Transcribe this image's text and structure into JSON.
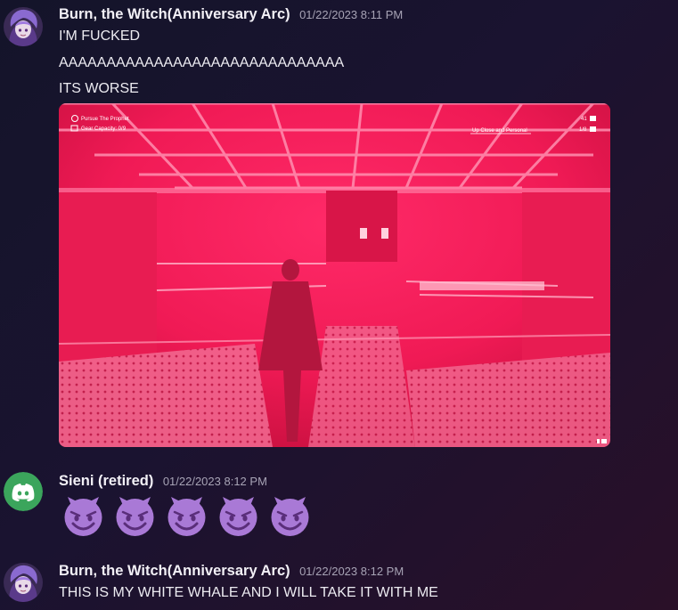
{
  "messages": [
    {
      "author": "Burn, the Witch(Anniversary Arc)",
      "timestamp": "01/22/2023 8:11 PM",
      "lines": [
        "I'M FUCKED",
        "AAAAAAAAAAAAAAAAAAAAAAAAAAAAAA",
        "ITS WORSE"
      ],
      "attachment": {
        "hud_objective": "Pursue The Prophet",
        "hud_gear": "Gear Capacity: 0/9",
        "hud_challenge": "Up Close and Personal",
        "hud_count": "41",
        "hud_progress": "1/8"
      }
    },
    {
      "author": "Sieni (retired)",
      "timestamp": "01/22/2023 8:12 PM",
      "emojis": [
        "smiling-imp",
        "smiling-imp",
        "smiling-imp",
        "smiling-imp",
        "smiling-imp"
      ]
    },
    {
      "author": "Burn, the Witch(Anniversary Arc)",
      "timestamp": "01/22/2023 8:12 PM",
      "lines": [
        "THIS IS MY WHITE WHALE AND I WILL TAKE IT WITH ME"
      ]
    }
  ],
  "colors": {
    "background": "#1a1330",
    "author": "#f2f0f6",
    "timestamp": "#a7a3b5",
    "discord_avatar": "#3ba55c",
    "image_tint": "#ff1f5a",
    "emoji": "#a979d6"
  }
}
